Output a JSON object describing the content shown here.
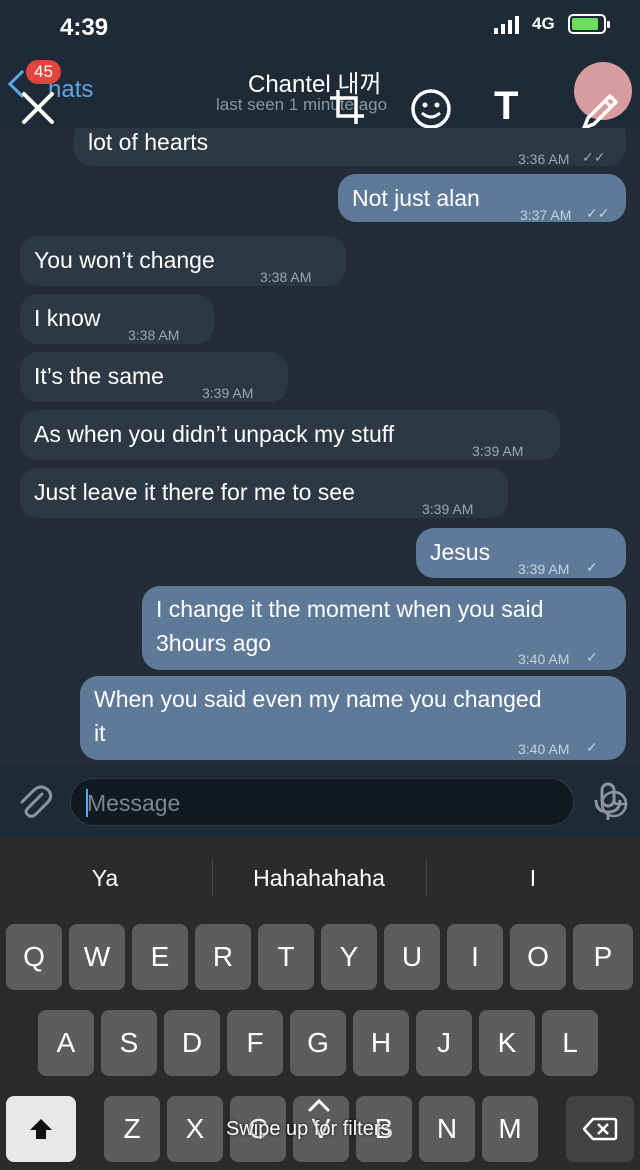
{
  "status": {
    "time": "4:39",
    "network": "4G"
  },
  "header": {
    "unread_badge": "45",
    "back_label": "hats",
    "contact_name": "Chantel 내꺼",
    "last_seen": "last seen 1 minute ago"
  },
  "messages": [
    {
      "dir": "in",
      "text": "lot of hearts",
      "time": "3:36 AM",
      "status": "read"
    },
    {
      "dir": "out",
      "text": "Not just alan",
      "time": "3:37 AM",
      "status": "read"
    },
    {
      "dir": "in",
      "text": "You won’t change",
      "time": "3:38 AM"
    },
    {
      "dir": "in",
      "text": "I know",
      "time": "3:38 AM"
    },
    {
      "dir": "in",
      "text": "It’s the same",
      "time": "3:39 AM"
    },
    {
      "dir": "in",
      "text": "As when you didn’t unpack my stuff",
      "time": "3:39 AM"
    },
    {
      "dir": "in",
      "text": "Just leave it there for me to see",
      "time": "3:39 AM"
    },
    {
      "dir": "out",
      "text": "Jesus",
      "time": "3:39 AM",
      "status": "sent"
    },
    {
      "dir": "out",
      "text_line1": "I change it the moment when you said",
      "text_line2": "3hours ago",
      "time": "3:40 AM",
      "status": "sent"
    },
    {
      "dir": "out",
      "text_line1": "When you said even my name you changed",
      "text_line2": "it",
      "time": "3:40 AM",
      "status": "sent"
    }
  ],
  "composer": {
    "placeholder": "Message"
  },
  "keyboard": {
    "suggestions": [
      "Ya",
      "Hahahahaha",
      "I"
    ],
    "row1": [
      "Q",
      "W",
      "E",
      "R",
      "T",
      "Y",
      "U",
      "I",
      "O",
      "P"
    ],
    "row2": [
      "A",
      "S",
      "D",
      "F",
      "G",
      "H",
      "J",
      "K",
      "L"
    ],
    "row3": [
      "Z",
      "X",
      "C",
      "V",
      "B",
      "N",
      "M"
    ],
    "swipe_hint": "Swipe up for filters"
  },
  "colors": {
    "accent": "#5ea6e8",
    "outgoing": "#5f7a99",
    "incoming": "#2c3844",
    "badge": "#e0463c"
  }
}
